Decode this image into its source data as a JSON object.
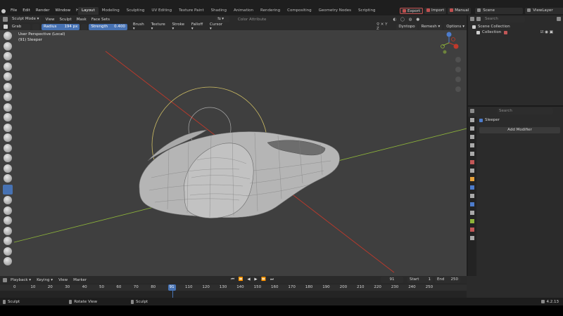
{
  "app": {
    "menus": [
      "File",
      "Edit",
      "Render",
      "Window",
      "Help"
    ],
    "workspaces": [
      "Layout",
      "Modeling",
      "Sculpting",
      "UV Editing",
      "Texture Paint",
      "Shading",
      "Animation",
      "Rendering",
      "Compositing",
      "Geometry Nodes",
      "Scripting"
    ],
    "active_workspace": "Layout",
    "export": "Export",
    "import": "Import",
    "manual": "Manual",
    "scene": "Scene",
    "viewlayer": "ViewLayer"
  },
  "header": {
    "mode": "Sculpt Mode",
    "view": "View",
    "sculpt": "Sculpt",
    "mask": "Mask",
    "face_sets": "Face Sets",
    "color_attribute": "Color Attribute",
    "dyntopo": "Dyntopo",
    "remesh": "Remesh",
    "options": "Options"
  },
  "toolsettings": {
    "brush": "Grab",
    "radius_label": "Radius",
    "radius_value": "194 px",
    "strength_label": "Strength",
    "strength_value": "0.400",
    "menus": [
      "Brush",
      "Texture",
      "Stroke",
      "Falloff",
      "Cursor"
    ]
  },
  "viewport": {
    "perspective": "User Perspective (Local)",
    "object": "(91) Sleeper"
  },
  "outliner": {
    "search_placeholder": "Search",
    "scene_collection": "Scene Collection",
    "collection": "Collection"
  },
  "properties": {
    "search_placeholder": "Search",
    "object": "Sleeper",
    "add_modifier": "Add Modifier"
  },
  "timeline": {
    "menus": [
      "Playback",
      "Keying",
      "View",
      "Marker"
    ],
    "current_frame": "91",
    "start_label": "Start",
    "start": "1",
    "end_label": "End",
    "end": "250",
    "ticks": [
      "0",
      "10",
      "20",
      "30",
      "40",
      "50",
      "60",
      "70",
      "80",
      "91",
      "110",
      "120",
      "130",
      "140",
      "150",
      "160",
      "170",
      "180",
      "190",
      "200",
      "210",
      "220",
      "230",
      "240",
      "250"
    ]
  },
  "status": {
    "left": "Sculpt",
    "mid": "Rotate View",
    "right": "Sculpt",
    "version": "4.2.13"
  },
  "colors": {
    "accent": "#4772b3",
    "axis_x": "#c0392b",
    "axis_y": "#8db33a",
    "brush_circle": "#e8d46a"
  }
}
